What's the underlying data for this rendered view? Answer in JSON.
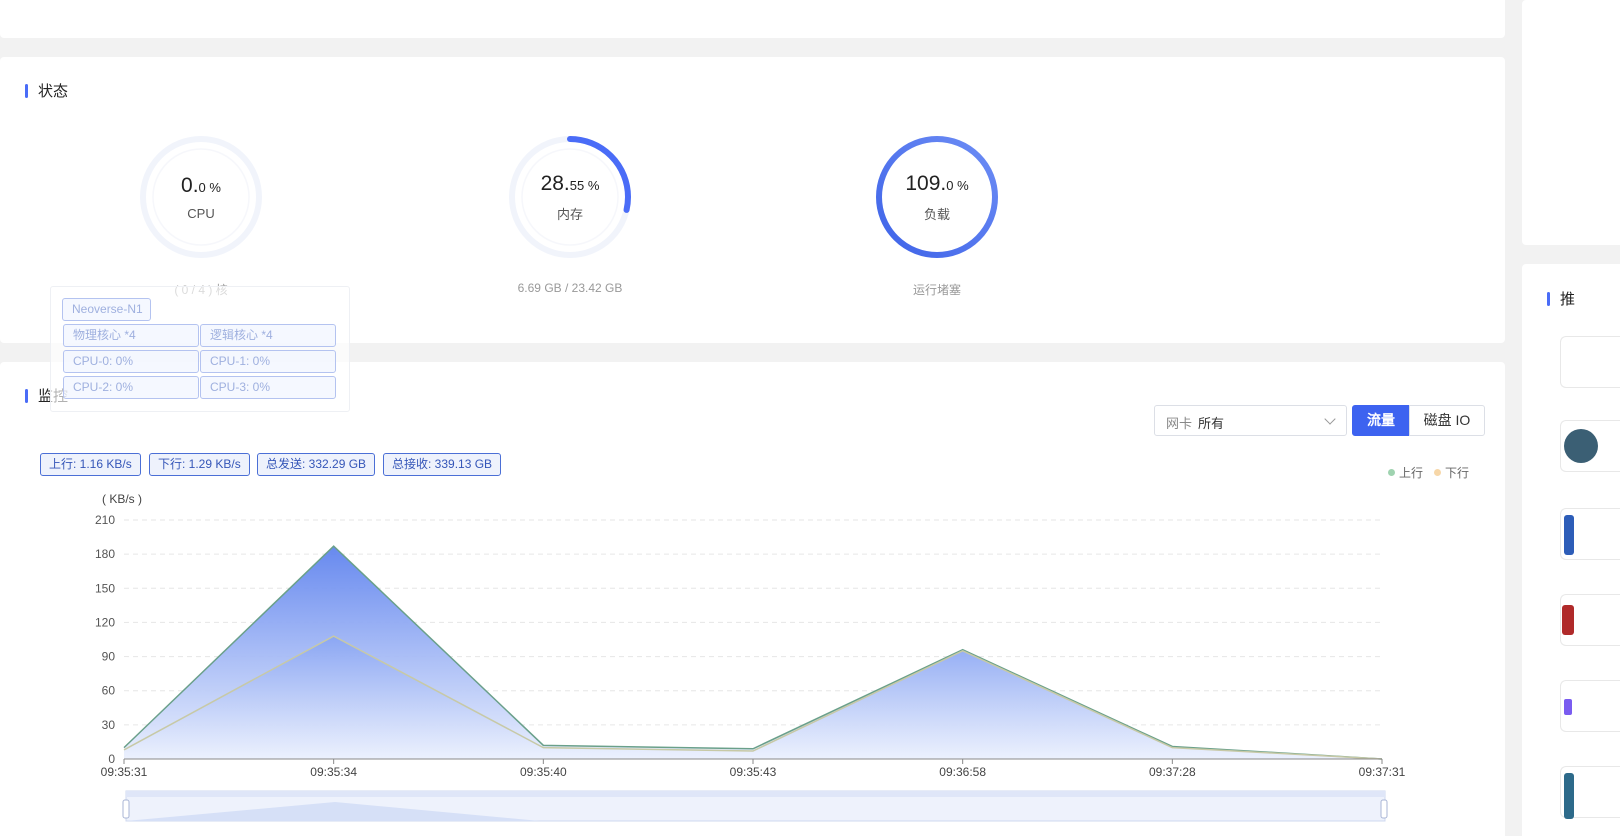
{
  "status": {
    "title": "状态",
    "gauges": [
      {
        "key": "cpu",
        "int": "0.",
        "dec": "0 %",
        "label": "CPU",
        "sub": "( 0 / 4 ) 核",
        "percent": 0
      },
      {
        "key": "mem",
        "int": "28.",
        "dec": "55 %",
        "label": "内存",
        "sub": "6.69 GB / 23.42 GB",
        "percent": 28.55
      },
      {
        "key": "load",
        "int": "109.",
        "dec": "0 %",
        "label": "负载",
        "sub": "运行堵塞",
        "percent": 100
      }
    ],
    "cpu_tooltip": {
      "model": "Neoverse-N1",
      "physical": "物理核心 *4",
      "logical": "逻辑核心 *4",
      "cores": [
        "CPU-0: 0%",
        "CPU-1: 0%",
        "CPU-2: 0%",
        "CPU-3: 0%"
      ]
    }
  },
  "monitor": {
    "title": "监控",
    "nic_prefix": "网卡",
    "nic_value": "所有",
    "tab_flow": "流量",
    "tab_io": "磁盘 IO",
    "stats": [
      "上行: 1.16 KB/s",
      "下行: 1.29 KB/s",
      "总发送: 332.29 GB",
      "总接收: 339.13 GB"
    ],
    "legend": [
      {
        "name": "上行",
        "color": "#9fd3b0"
      },
      {
        "name": "下行",
        "color": "#f7d7a8"
      }
    ]
  },
  "right_panel": {
    "title_glyph": "推"
  },
  "colors": {
    "accent": "#3d63f0",
    "gauge_track": "#f1f4fb",
    "gauge_fill": "#4a6cf7"
  },
  "chart_data": {
    "type": "area",
    "x": [
      "09:35:31",
      "09:35:34",
      "09:35:40",
      "09:35:43",
      "09:36:58",
      "09:37:28",
      "09:37:31"
    ],
    "series": [
      {
        "name": "上行",
        "values": [
          10,
          187,
          12,
          9,
          96,
          11,
          0
        ]
      },
      {
        "name": "下行",
        "values": [
          8,
          108,
          10,
          7,
          95,
          10,
          0
        ]
      }
    ],
    "ylabel": "( KB/s )",
    "yticks": [
      0,
      30,
      60,
      90,
      120,
      150,
      180,
      210
    ],
    "ylim": [
      0,
      210
    ],
    "grid": true,
    "legend_position": "top-right"
  }
}
